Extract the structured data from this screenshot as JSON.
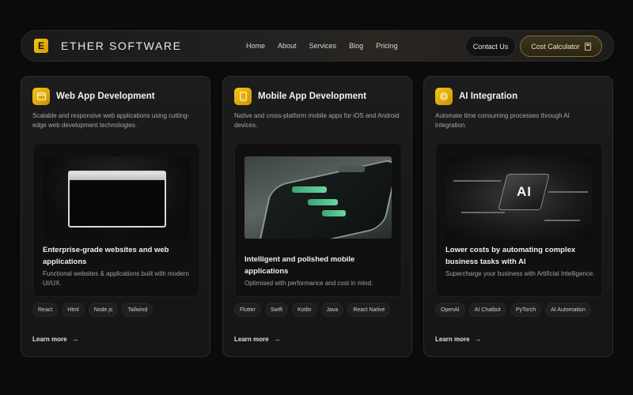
{
  "nav": {
    "logo_letter": "E",
    "brand": "ETHER SOFTWARE",
    "items": [
      {
        "label": "Home"
      },
      {
        "label": "About"
      },
      {
        "label": "Services"
      },
      {
        "label": "Blog"
      },
      {
        "label": "Pricing"
      }
    ],
    "contact_label": "Contact Us",
    "cost_label": "Cost Calculator"
  },
  "colors": {
    "accent": "#f5c518",
    "background": "#0b0b0b",
    "card": "#1a1a1a"
  },
  "cards": [
    {
      "icon": "browser-window-icon",
      "title": "Web App Development",
      "description": "Scalable and responsive web applications using cutting-edge web development technologies.",
      "feature_title": "Enterprise-grade websites and web applications",
      "feature_sub": "Functional websites & applications built with modern UI/UX.",
      "tags": [
        "React",
        "Html",
        "Node.js",
        "Tailwind"
      ],
      "learn_more": "Learn more"
    },
    {
      "icon": "mobile-phone-icon",
      "title": "Mobile App Development",
      "description": "Native and cross-platform mobile apps for iOS and Android devices.",
      "feature_title": "Intelligent and polished mobile applications",
      "feature_sub": "Optimised with performance and cost in mind.",
      "tags": [
        "Flutter",
        "Swift",
        "Kotlin",
        "Java",
        "React Native"
      ],
      "learn_more": "Learn more"
    },
    {
      "icon": "ai-chip-icon",
      "title": "AI Integration",
      "description": "Automate time consuming processes through AI integration.",
      "feature_title": "Lower costs by automating complex business tasks with AI",
      "feature_sub": "Supercharge your business with Artificial Intelligence.",
      "tags": [
        "OpenAI",
        "AI Chatbot",
        "PyTorch",
        "AI Automation"
      ],
      "learn_more": "Learn more",
      "image_text": "AI"
    }
  ]
}
